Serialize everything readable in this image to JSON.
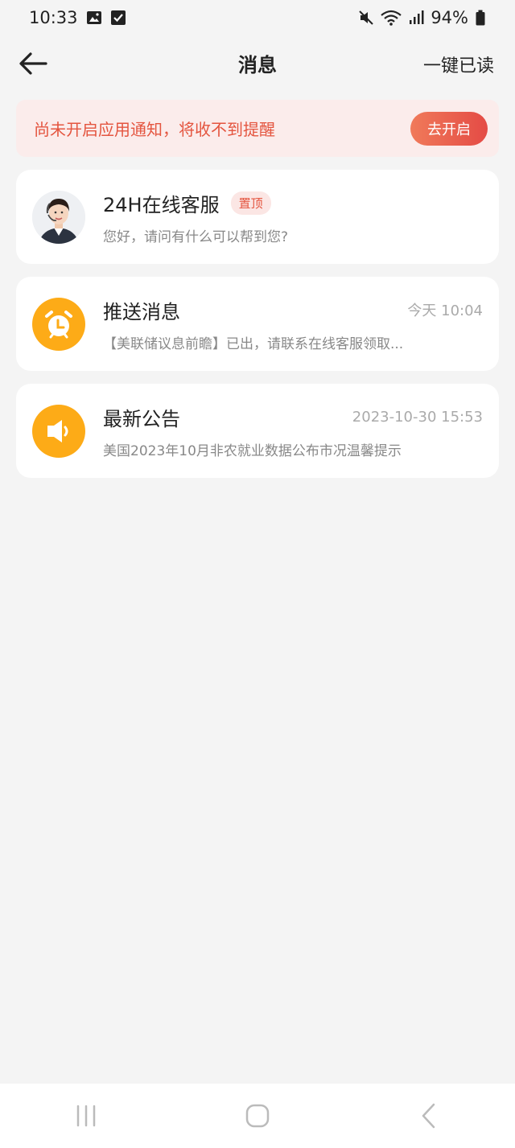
{
  "status_bar": {
    "time": "10:33",
    "battery": "94%"
  },
  "header": {
    "title": "消息",
    "mark_all_read": "一键已读"
  },
  "banner": {
    "text": "尚未开启应用通知，将收不到提醒",
    "button_label": "去开启"
  },
  "messages": [
    {
      "title": "24H在线客服",
      "badge": "置顶",
      "time": "",
      "preview": "您好，请问有什么可以帮到您?",
      "icon": "customer-service-avatar"
    },
    {
      "title": "推送消息",
      "badge": "",
      "time": "今天 10:04",
      "preview": "【美联储议息前瞻】已出，请联系在线客服领取...",
      "icon": "alarm-clock-icon"
    },
    {
      "title": "最新公告",
      "badge": "",
      "time": "2023-10-30 15:53",
      "preview": "美国2023年10月非农就业数据公布市况温馨提示",
      "icon": "speaker-icon"
    }
  ],
  "colors": {
    "accent": "#e4553f",
    "orange": "#fdab17",
    "background": "#f4f4f4"
  }
}
